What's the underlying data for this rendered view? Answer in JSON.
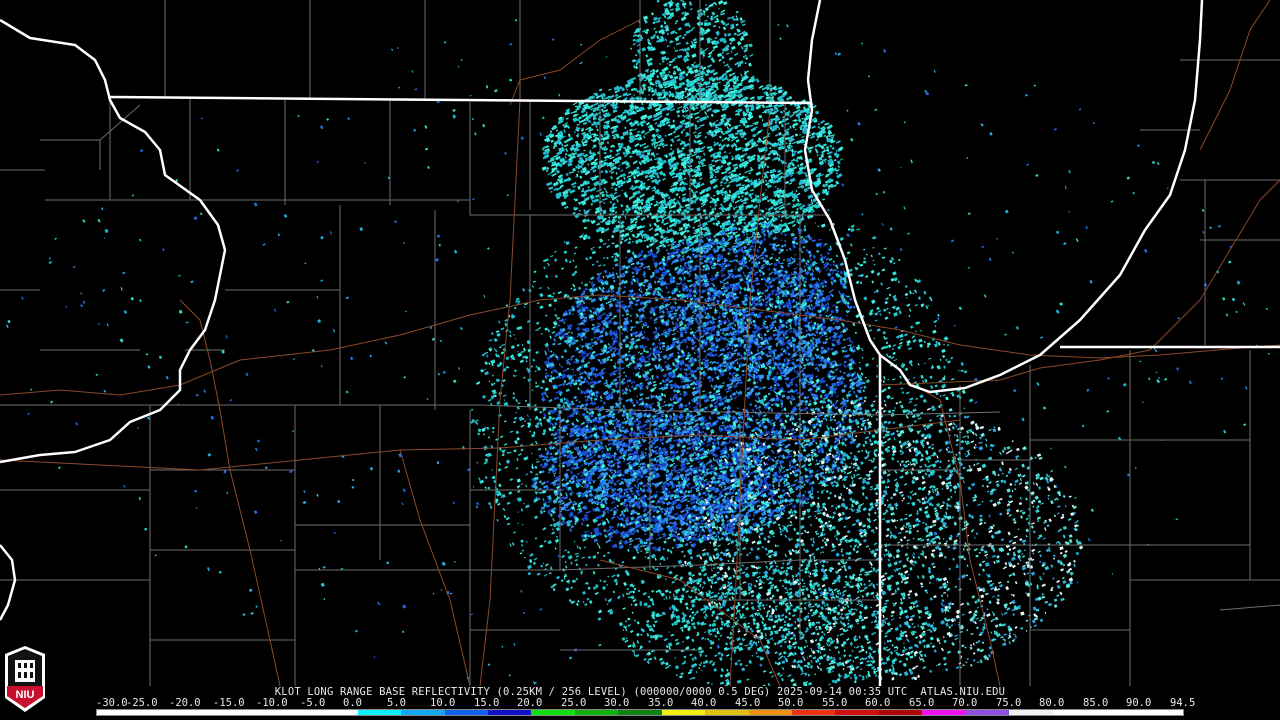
{
  "caption": "KLOT LONG RANGE BASE REFLECTIVITY (0.25KM / 256 LEVEL) (000000/0000 0.5 DEG) 2025-09-14 00:35 UTC  ATLAS.NIU.EDU",
  "logo_text": "NIU",
  "colors": {
    "background": "#000000",
    "state_border": "#ffffff",
    "county_line": "#6e6e6e",
    "highway": "#8b4a2a",
    "echo_cyan": "#30d8d0",
    "echo_blue": "#2060e8",
    "logo_red": "#c8102e"
  },
  "scale": {
    "labels": [
      "-30.0",
      "-25.0",
      "-20.0",
      "-15.0",
      "-10.0",
      "-5.0",
      "0.0",
      "5.0",
      "10.0",
      "15.0",
      "20.0",
      "25.0",
      "30.0",
      "35.0",
      "40.0",
      "45.0",
      "50.0",
      "55.0",
      "60.0",
      "65.0",
      "70.0",
      "75.0",
      "80.0",
      "85.0",
      "90.0",
      "94.5"
    ],
    "colors": [
      "#ffffff",
      "#ffffff",
      "#ffffff",
      "#ffffff",
      "#ffffff",
      "#ffffff",
      "#08f0f8",
      "#10a8f0",
      "#1060f0",
      "#1010c8",
      "#10e010",
      "#10b010",
      "#108010",
      "#f0f010",
      "#e0c010",
      "#f09010",
      "#f03010",
      "#d01010",
      "#b00808",
      "#f010f0",
      "#9050e0",
      "#f0f0f0",
      "#ffffff",
      "#ffffff",
      "#ffffff"
    ]
  }
}
